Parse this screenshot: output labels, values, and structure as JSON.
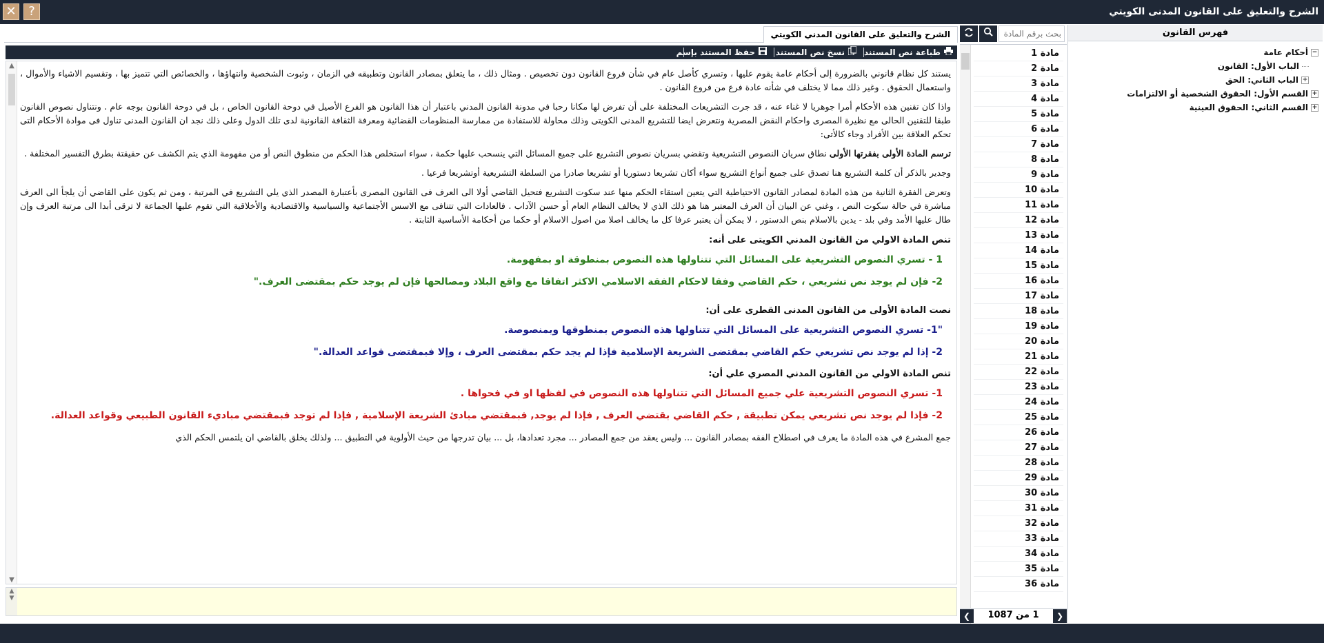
{
  "window": {
    "title": "الشرح والتعليق على القانون المدنى الكويتي",
    "close_glyph": "✕",
    "help_glyph": "?"
  },
  "index": {
    "header": "فهرس القانون",
    "tree": [
      {
        "label": "أحكام عامة",
        "level": 0,
        "toggle": "−"
      },
      {
        "label": "الباب الأول: القانون",
        "level": 1,
        "toggle": ""
      },
      {
        "label": "الباب الثاني: الحق",
        "level": 1,
        "toggle": "+"
      },
      {
        "label": "القسم الأول: الحقوق الشخصية أو الالتزامات",
        "level": 0,
        "toggle": "+"
      },
      {
        "label": "القسم الثاني: الحقوق العينية",
        "level": 0,
        "toggle": "+"
      }
    ]
  },
  "search": {
    "placeholder": "بحث برقم المادة",
    "search_icon": "magnifier-icon",
    "refresh_icon": "refresh-icon"
  },
  "articles": {
    "items": [
      "مادة 1",
      "مادة 2",
      "مادة 3",
      "مادة 4",
      "مادة 5",
      "مادة 6",
      "مادة 7",
      "مادة 8",
      "مادة 9",
      "مادة 10",
      "مادة 11",
      "مادة 12",
      "مادة 13",
      "مادة 14",
      "مادة 15",
      "مادة 16",
      "مادة 17",
      "مادة 18",
      "مادة 19",
      "مادة 20",
      "مادة 21",
      "مادة 22",
      "مادة 23",
      "مادة 24",
      "مادة 25",
      "مادة 26",
      "مادة 27",
      "مادة 28",
      "مادة 29",
      "مادة 30",
      "مادة 31",
      "مادة 32",
      "مادة 33",
      "مادة 34",
      "مادة 35",
      "مادة 36"
    ],
    "pager_text": "1 من 1087",
    "prev_glyph": "❮",
    "next_glyph": "❯"
  },
  "content": {
    "tab_label": "الشرح والتعليق على القانون المدني الكويتي",
    "toolbar": {
      "print_label": "طباعة نص المستند",
      "copy_label": "نسخ نص المستند",
      "save_label": "حفظ المستند بإسم"
    },
    "paragraphs": [
      "يستند كل نظام قانوني بالضرورة إلى أحكام عامة يقوم عليها ، وتسري كأصل عام في شأن فروع القانون دون تخصيص . ومثال ذلك ، ما يتعلق بمصادر القانون وتطبيقه في الزمان ، وثبوت الشخصية وانتهاؤها ، والخصائص التي تتميز بها ، وتقسيم الاشياء والأموال ، واستعمال الحقوق . وغير ذلك مما لا يختلف في شأنه عادة فرع من فروع القانون .",
      "واذا كان تقنين هذه الأحكام أمرا جوهريا لا غناء عنه ، قد جرت التشريعات المختلفة على أن تفرض لها مكانا رحبا في مدونة القانون المدني باعتبار أن هذا القانون هو الفرع الأصيل في دوحة القانون الخاص ، بل في دوحة القانون بوجه عام . ونتناول نصوص القانون طبقا للتقنين الحالى مع نظيرة المصرى واحكام النقض المصرية ونتعرض ايضا للتشريع المدنى الكويتى وذلك محاولة للاستفادة من ممارسة المنظومات القضائية ومعرفة الثقافة القانونية لدى تلك الدول وعلى ذلك نجد ان القانون المدنى تناول فى موادة الأحكام التى تحكم العلاقة بين الأفراد وجاء كالأتى:"
    ],
    "lead_bold": "ترسم المادة الأولى بفقرتها الأولى",
    "lead_rest": " نطاق سريان النصوص التشريعية وتقضي بسريان نصوص التشريع على جميع المسائل التي ينسحب عليها حكمة ، سواء استخلص هذا الحكم من منطوق النص أو من مفهومة الذي يتم الكشف عن حقيقتة بطرق التفسير المختلفة .",
    "paragraphs2": [
      "وجدير بالذكر أن كلمة التشريع هنا تصدق على جميع أنواع التشريع سواء أكان تشريعا دستوريا أو تشريعا صادرا من السلطة التشريعية أوتشريعا فرعيا .",
      "وتعرض الفقرة الثانية من هذه المادة لمصادر القانون الاحتياطية التي يتعين استقاء الحكم منها عند سكوت التشريع فتحيل القاضي أولا الى العرف فى القانون المصرى بأعتبارة المصدر الذي يلي التشريع في المرتبة ، ومن ثم يكون على القاضي أن يلجأ الى العرف مباشرة في حالة سكوت النص ، وغني عن البيان أن العرف المعتبر هنا هو ذلك الذي لا يخالف النظام العام أو حسن الآداب . فالعادات التي تتنافى مع الاسس الأجتماعية والسياسية والاقتصادية والأخلاقية التي تقوم عليها الجماعة لا ترقى أبدا الى مرتبة العرف وإن طال عليها الأمد وفي بلد - يدين بالاسلام بنص الدستور ، لا يمكن أن يعتبر عرفا كل ما يخالف اصلا من اصول الاسلام أو حكما من أحكامة الأساسية الثابتة ."
    ],
    "heading_kw": "تنص المادة الاولي من القانون المدني الكويتى على أنه:",
    "kw_lines": [
      "1 - تسري النصوص التشريعية على المسائل التي تتناولها هذه النصوص بمنطوقة او بمفهومة.",
      "2- فإن لم يوجد نص تشريعي ، حكم القاضي وفقا لاحكام الفقة الاسلامي الاكثر اتفاقا مع واقع البلاد ومصالحها فإن لم يوجد حكم بمقتضى العرف.\""
    ],
    "heading_qa": "نصت المادة الأولى من القانون المدنى القطرى على أن:",
    "qa_lines": [
      "\"1- تسري النصوص التشريعية على المسائل التي تتناولها هذه النصوص بمنطوقها وبمنصوصة.",
      "2- إذا لم يوجد نص تشريعي حكم القاضي بمقتضى الشريعة الإسلامية فإذا لم يجد حكم بمقتضى العرف ، وإلا فبمقتضى قواعد العدالة.\""
    ],
    "heading_eg": "تنص المادة الاولي من القانون المدني المصري علي أن:",
    "eg_lines": [
      "1- تسري النصوص التشريعية علي جميع المسائل التي تتناولها هذه النصوص في لفظها او في فحواها .",
      "2- فإذا لم يوجد نص تشريعي يمكن تطبيقة , حكم القاضي بقتضي العرف , فإذا لم يوجد, فبمقتضي مبادئ الشريعة الإسلامية , فإذا لم توجد فبمقتضي مباديء القانون الطبيعي وقواعد العدالة."
    ],
    "tail_text": "جمع المشرع في هذه المادة ما يعرف في اصطلاح الفقه بمصادر القانون ... وليس يعقد من جمع المصادر ... مجرد تعدادها، بل ... بيان تدرجها من حيث الأولوية في التطبيق ... ولذلك يخلق بالقاضي ان يلتمس الحكم الذي"
  },
  "colors": {
    "bar": "#1f2836",
    "green": "#2e7d1f",
    "blue": "#1b1f8c",
    "red": "#c81a1a",
    "note_bg": "#ffffe1"
  }
}
